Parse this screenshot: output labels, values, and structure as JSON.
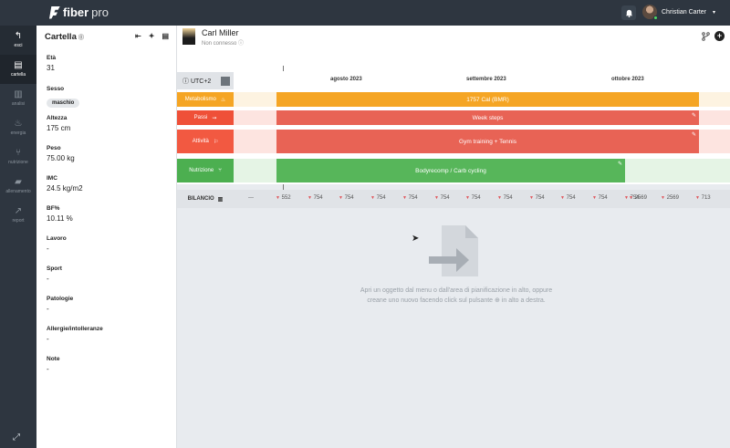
{
  "topbar": {
    "brand": "fiber",
    "brand_suffix": "pro",
    "user_name": "Christian Carter",
    "caret": "▾"
  },
  "nav": {
    "items": [
      {
        "label": "esci",
        "icon": "back-arrow-icon",
        "glyph": "↰"
      },
      {
        "label": "cartella",
        "icon": "clipboard-icon",
        "glyph": "▤"
      },
      {
        "label": "analisi",
        "icon": "analysis-icon",
        "glyph": "▥"
      },
      {
        "label": "energia",
        "icon": "flame-icon",
        "glyph": "♨"
      },
      {
        "label": "nutrizione",
        "icon": "fork-knife-icon",
        "glyph": "⑂"
      },
      {
        "label": "allenamento",
        "icon": "dumbbell-icon",
        "glyph": "▰"
      },
      {
        "label": "report",
        "icon": "chart-icon",
        "glyph": "↗"
      }
    ],
    "expand_glyph": "⤢"
  },
  "sidebar": {
    "title": "Cartella",
    "title_suffix": "⓪",
    "fields": [
      {
        "label": "Età",
        "value": "31"
      },
      {
        "label": "Sesso",
        "value": "maschio",
        "pill": true
      },
      {
        "label": "Altezza",
        "value": "175 cm"
      },
      {
        "label": "Peso",
        "value": "75.00 kg"
      },
      {
        "label": "IMC",
        "value": "24.5 kg/m2"
      },
      {
        "label": "BF%",
        "value": "10.11 %"
      },
      {
        "label": "Lavoro",
        "value": "-"
      },
      {
        "label": "Sport",
        "value": "-"
      },
      {
        "label": "Patologie",
        "value": "-"
      },
      {
        "label": "Allergie/intolleranze",
        "value": "-"
      },
      {
        "label": "Note",
        "value": "-"
      }
    ]
  },
  "client": {
    "name": "Carl Miller",
    "status": "Non connesso ⓘ"
  },
  "timeline": {
    "timezone": "ⓘ UTC+2",
    "months": [
      "agosto 2023",
      "settembre 2023",
      "ottobre 2023"
    ],
    "rows": [
      {
        "label": "Metabolismo",
        "icon": "flame-icon",
        "glyph": "🔥︎",
        "color": "#f5a524",
        "bg": "#fdf3e1",
        "bar": "1757 Cal (BMR)"
      },
      {
        "label": "Passi",
        "icon": "footsteps-icon",
        "glyph": "⇝",
        "color": "#ef5038",
        "bg": "#fde4e0",
        "bar": "Week steps"
      },
      {
        "label": "Attività",
        "icon": "runner-icon",
        "glyph": "🏃︎",
        "color": "#f25941",
        "bg": "#fde4e0",
        "bar": "Gym training + Tennis"
      },
      {
        "label": "Nutrizione",
        "icon": "fork-knife-icon",
        "glyph": "⑂",
        "color": "#4caf50",
        "bg": "#e5f4e5",
        "bar": "Bodyrecomp / Carb cycling"
      }
    ],
    "edit_glyph": "✎"
  },
  "balance": {
    "label": "BILANCIO",
    "values": [
      "---",
      "552",
      "754",
      "754",
      "754",
      "754",
      "754",
      "754",
      "754",
      "754",
      "754",
      "754",
      "754",
      "2569",
      "2569",
      "713"
    ]
  },
  "empty_state": {
    "line1": "Apri un oggetto dal menu o dall'area di pianificazione in alto, oppure",
    "line2": "creane uno nuovo facendo click sul pulsante ⊕ in alto a destra."
  }
}
